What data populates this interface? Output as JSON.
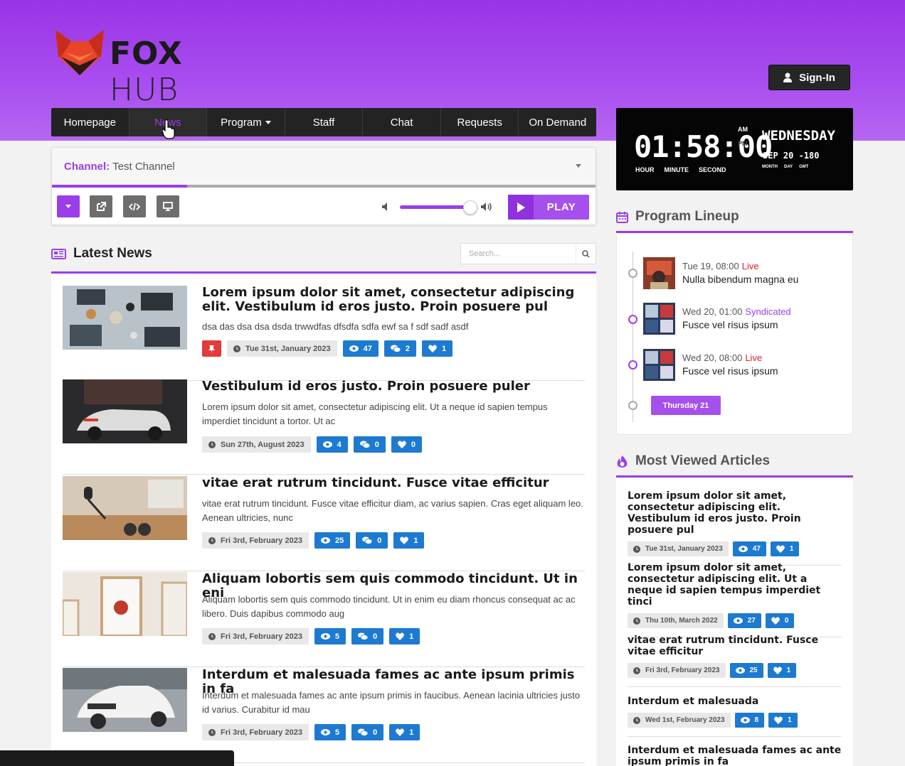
{
  "brand": {
    "name_bold": "FOX",
    "name_light": "HUB",
    "primary": "#9b3de8"
  },
  "header": {
    "signin_label": "Sign-In"
  },
  "nav": {
    "items": [
      "Homepage",
      "News",
      "Program",
      "Staff",
      "Chat",
      "Requests",
      "On Demand"
    ],
    "active": "News"
  },
  "player": {
    "channel_label": "Channel:",
    "channel_value": "Test Channel",
    "play_label": "PLAY",
    "progress_fraction": 0.25,
    "volume_fraction": 0.9
  },
  "latest_news": {
    "title": "Latest News",
    "search_placeholder": "Search...",
    "items": [
      {
        "title": "Lorem ipsum dolor sit amet, consectetur adipiscing elit. Vestibulum id eros justo. Proin posuere pul",
        "excerpt": "dsa das dsa dsa dsda trwwdfas dfsdfa sdfa ewf sa f sdf sadf asdf",
        "date": "Tue 31st, January 2023",
        "views": "47",
        "comments": "2",
        "likes": "1",
        "pinned": true
      },
      {
        "title": "Vestibulum id eros justo. Proin posuere puler",
        "excerpt": "Lorem ipsum dolor sit amet, consectetur adipiscing elit. Ut a neque id sapien tempus imperdiet tincidunt a tortor. Ut ac",
        "date": "Sun 27th, August 2023",
        "views": "4",
        "comments": "0",
        "likes": "0",
        "pinned": false
      },
      {
        "title": "vitae erat rutrum tincidunt. Fusce vitae efficitur",
        "excerpt": "vitae erat rutrum tincidunt. Fusce vitae efficitur diam, ac varius sapien. Cras eget aliquam leo. Aenean ultricies, nunc",
        "date": "Fri 3rd, February 2023",
        "views": "25",
        "comments": "0",
        "likes": "1",
        "pinned": false
      },
      {
        "title": "Aliquam lobortis sem quis commodo tincidunt. Ut in eni",
        "excerpt": "Aliquam lobortis sem quis commodo tincidunt. Ut in enim eu diam rhoncus consequat ac ac libero. Duis dapibus commodo aug",
        "date": "Fri 3rd, February 2023",
        "views": "5",
        "comments": "0",
        "likes": "1",
        "pinned": false
      },
      {
        "title": "Interdum et malesuada fames ac ante ipsum primis in fa",
        "excerpt": "Interdum et malesuada fames ac ante ipsum primis in faucibus. Aenean lacinia ultricies justo id varius. Curabitur id mau",
        "date": "Fri 3rd, February 2023",
        "views": "5",
        "comments": "0",
        "likes": "1",
        "pinned": false
      }
    ]
  },
  "clock": {
    "time": "01:58:00",
    "am": "AM",
    "pm": "PM",
    "labels": [
      "HOUR",
      "MINUTE",
      "SECOND"
    ],
    "day": "WEDNESDAY",
    "date": "SEP 20 -180",
    "date_labels": [
      "MONTH",
      "DAY",
      "GMT"
    ]
  },
  "program_lineup": {
    "title": "Program Lineup",
    "items": [
      {
        "when": "Tue 19, 08:00",
        "tag": "Live",
        "tag_color": "#e0202a",
        "show": "Nulla bibendum magna eu"
      },
      {
        "when": "Wed 20, 01:00",
        "tag": "Syndicated",
        "tag_color": "#9b3de8",
        "show": "Fusce vel risus ipsum"
      },
      {
        "when": "Wed 20, 08:00",
        "tag": "Live",
        "tag_color": "#e0202a",
        "show": "Fusce vel risus ipsum"
      }
    ],
    "next_day_label": "Thursday 21"
  },
  "most_viewed": {
    "title": "Most Viewed Articles",
    "items": [
      {
        "title": "Lorem ipsum dolor sit amet, consectetur adipiscing elit. Vestibulum id eros justo. Proin posuere pul",
        "date": "Tue 31st, January 2023",
        "views": "47",
        "likes": "1"
      },
      {
        "title": "Lorem ipsum dolor sit amet, consectetur adipiscing elit. Ut a neque id sapien tempus imperdiet tinci",
        "date": "Thu 10th, March 2022",
        "views": "27",
        "likes": "0"
      },
      {
        "title": "vitae erat rutrum tincidunt. Fusce vitae efficitur",
        "date": "Fri 3rd, February 2023",
        "views": "25",
        "likes": "1"
      },
      {
        "title": "Interdum et malesuada",
        "date": "Wed 1st, February 2023",
        "views": "8",
        "likes": "1"
      },
      {
        "title": "Interdum et malesuada fames ac ante ipsum primis in fa",
        "date": "",
        "views": "",
        "likes": ""
      }
    ]
  }
}
